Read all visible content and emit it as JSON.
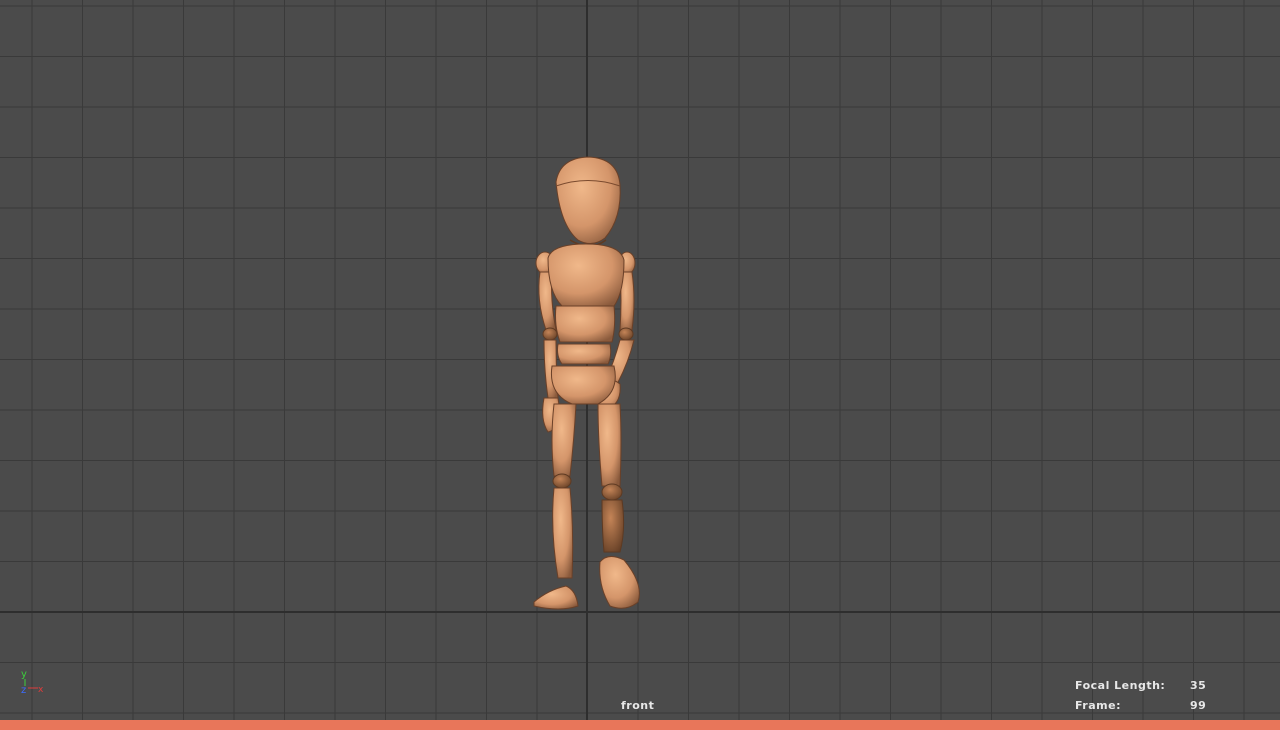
{
  "viewport": {
    "camera_name": "front",
    "background_color": "#4b4b4b",
    "grid_color": "#3a3a3a",
    "grid_axis_color": "#2e2e2e",
    "model_color": "#d99b6e"
  },
  "hud": {
    "focal_length_label": "Focal Length:",
    "focal_length_value": "35",
    "frame_label": "Frame:",
    "frame_value": "99"
  },
  "axis_gizmo": {
    "y_label": "y",
    "z_label": "z",
    "x_label": "x",
    "y_color": "#3ccf3c",
    "z_color": "#3c6cff",
    "x_color": "#e03c3c"
  },
  "timeline": {
    "accent_color": "#e8765a"
  }
}
